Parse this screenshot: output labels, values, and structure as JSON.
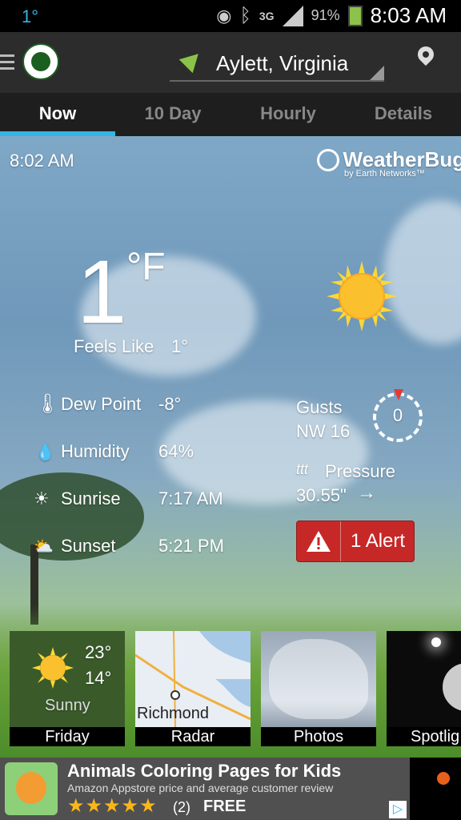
{
  "status_bar": {
    "temperature": "1°",
    "network": "3G",
    "battery_percent": "91%",
    "time": "8:03 AM"
  },
  "app_bar": {
    "location": "Aylett, Virginia"
  },
  "tabs": [
    {
      "label": "Now",
      "active": true
    },
    {
      "label": "10 Day",
      "active": false
    },
    {
      "label": "Hourly",
      "active": false
    },
    {
      "label": "Details",
      "active": false
    }
  ],
  "current": {
    "updated_time": "8:02 AM",
    "brand": "WeatherBug",
    "brand_sub": "by Earth Networks™",
    "temperature": "1",
    "unit": "°F",
    "feels_like_label": "Feels Like",
    "feels_like_value": "1°",
    "dew_point_label": "Dew Point",
    "dew_point_value": "-8°",
    "humidity_label": "Humidity",
    "humidity_value": "64%",
    "sunrise_label": "Sunrise",
    "sunrise_value": "7:17 AM",
    "sunset_label": "Sunset",
    "sunset_value": "5:21 PM",
    "gusts_label": "Gusts",
    "gusts_value": "NW 16",
    "gusts_dial_value": "0",
    "pressure_label": "Pressure",
    "pressure_value": "30.55\"",
    "alert_label": "1 Alert"
  },
  "tiles": [
    {
      "caption": "Friday",
      "high": "23°",
      "low": "14°",
      "condition": "Sunny"
    },
    {
      "caption": "Radar",
      "map_label": "Richmond"
    },
    {
      "caption": "Photos"
    },
    {
      "caption": "Spotlig"
    }
  ],
  "ad": {
    "title": "Animals Coloring Pages for Kids",
    "subtitle": "Amazon Appstore price and average customer review",
    "rating_count": "(2)",
    "price": "FREE",
    "rating_stars": 5
  },
  "colors": {
    "accent": "#33b5e5",
    "alert": "#c62828",
    "location_arrow": "#8bc34a"
  }
}
